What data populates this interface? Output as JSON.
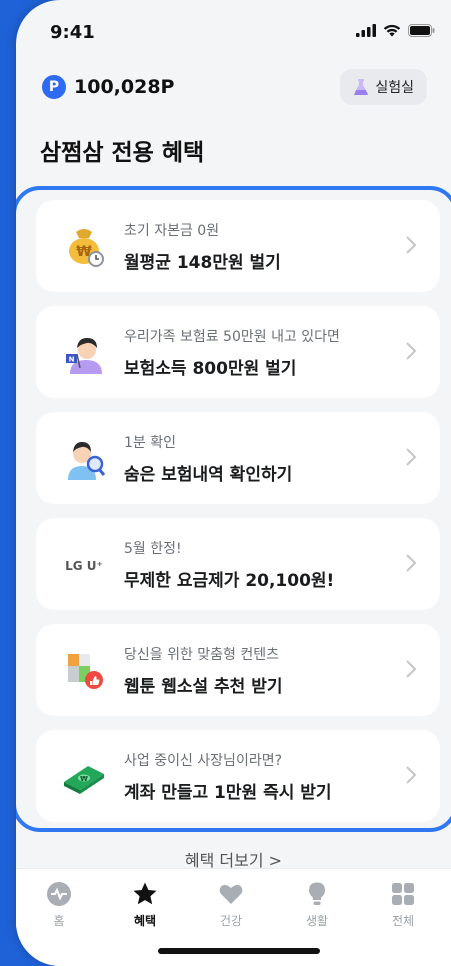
{
  "status": {
    "time": "9:41"
  },
  "header": {
    "points": "100,028P",
    "points_badge": "P",
    "lab_label": "실험실"
  },
  "page_title": "삼쩜삼 전용 혜택",
  "cards": [
    {
      "subtitle": "초기 자본금 0원",
      "title": "월평균 148만원 벌기",
      "icon": "money-bag-clock-icon"
    },
    {
      "subtitle": "우리가족 보험료 50만원 내고 있다면",
      "title": "보험소득 800만원 벌기",
      "icon": "person-flag-icon"
    },
    {
      "subtitle": "1분 확인",
      "title": "숨은 보험내역 확인하기",
      "icon": "person-magnifier-icon"
    },
    {
      "subtitle": "5월 한정!",
      "title": "무제한 요금제가 20,100원!",
      "icon": "lgu-plus-logo",
      "logo_text": "LG U⁺"
    },
    {
      "subtitle": "당신을 위한 맞춤형 컨텐츠",
      "title": "웹툰 웹소설 추천 받기",
      "icon": "content-thumbsup-icon"
    },
    {
      "subtitle": "사업 중이신 사장님이라면?",
      "title": "계좌 만들고 1만원 즉시 받기",
      "icon": "cash-stack-icon"
    }
  ],
  "more_link": "혜택 더보기 >",
  "tabs": [
    {
      "label": "홈",
      "icon": "home-icon",
      "active": false
    },
    {
      "label": "혜택",
      "icon": "star-icon",
      "active": true
    },
    {
      "label": "건강",
      "icon": "heart-icon",
      "active": false
    },
    {
      "label": "생활",
      "icon": "lightbulb-icon",
      "active": false
    },
    {
      "label": "전체",
      "icon": "grid-icon",
      "active": false
    }
  ],
  "colors": {
    "accent": "#2f6bf2",
    "highlight_border": "#2f78f2",
    "background": "#f4f5f7"
  }
}
